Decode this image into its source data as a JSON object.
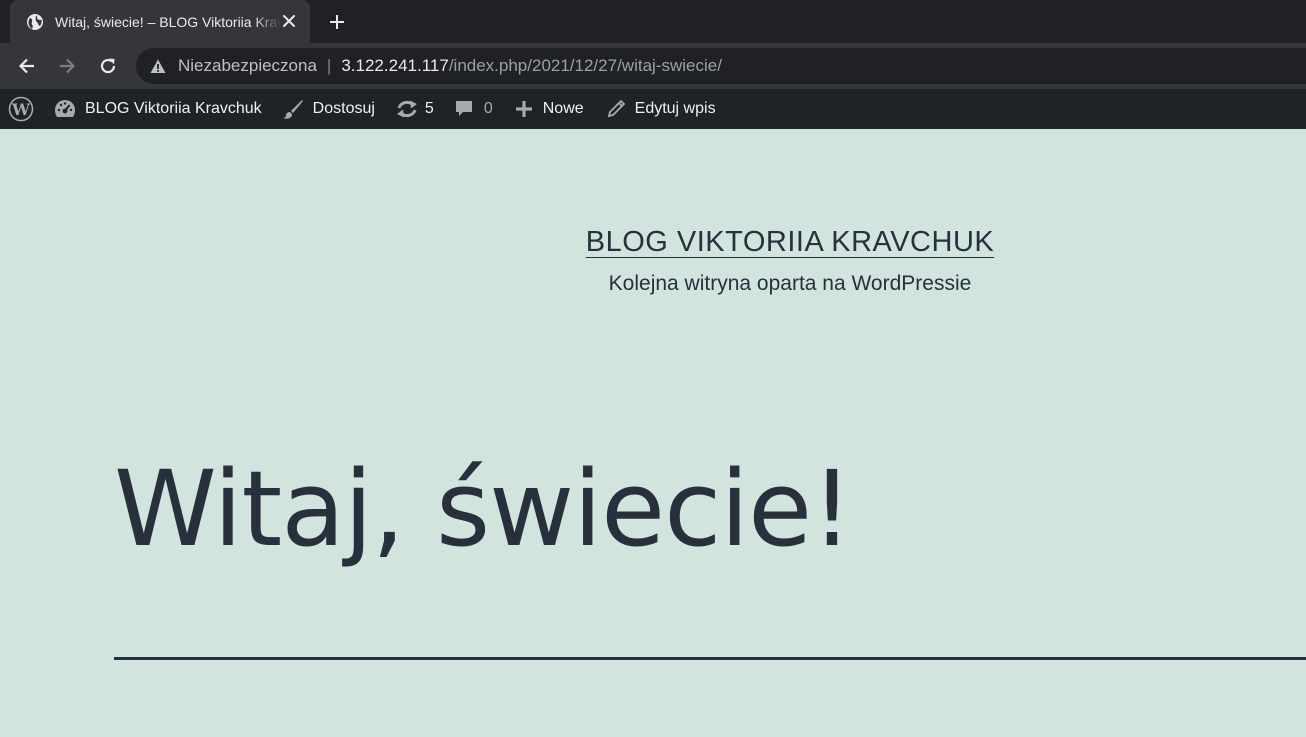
{
  "browser": {
    "tab_title": "Witaj, świecie! – BLOG Viktoriia Kravchuk",
    "security_label": "Niezabezpieczona",
    "url_host": "3.122.241.117",
    "url_path": "/index.php/2021/12/27/witaj-swiecie/"
  },
  "adminbar": {
    "site_name": "BLOG Viktoriia Kravchuk",
    "customize": "Dostosuj",
    "updates_count": "5",
    "comments_count": "0",
    "new": "Nowe",
    "edit_post": "Edytuj wpis"
  },
  "site": {
    "title": "BLOG VIKTORIIA KRAVCHUK",
    "description": "Kolejna witryna oparta na WordPressie"
  },
  "post": {
    "title": "Witaj, świecie!"
  },
  "colors": {
    "page_background": "#d1e4dd",
    "text": "#28303d",
    "adminbar": "#1d2327",
    "chrome_dark": "#202124",
    "chrome_tab": "#35363a"
  },
  "icons": {
    "tab_favicon": "globe-icon",
    "tab_close": "close-icon",
    "new_tab": "plus-icon",
    "back": "arrow-left-icon",
    "forward": "arrow-right-icon",
    "reload": "reload-icon",
    "security": "warning-icon",
    "wp_logo": "wordpress-logo-icon",
    "dashboard": "dashboard-icon",
    "customize": "brush-icon",
    "updates": "updates-icon",
    "comments": "comment-icon",
    "new": "plus-icon",
    "edit": "pencil-icon"
  }
}
